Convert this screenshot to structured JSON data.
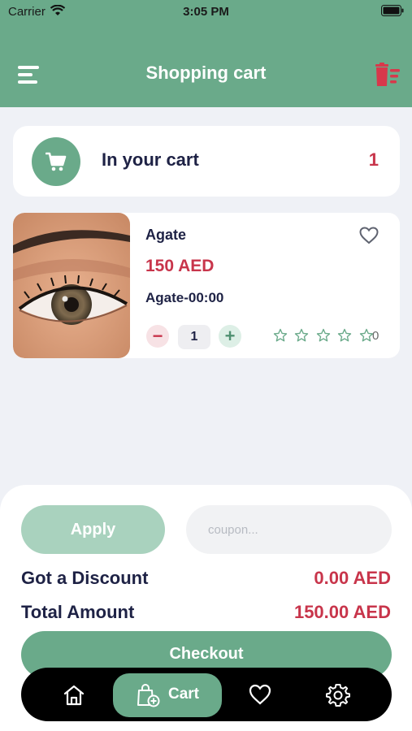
{
  "status_bar": {
    "carrier": "Carrier",
    "time": "3:05 PM"
  },
  "header": {
    "title": "Shopping cart"
  },
  "cart_summary": {
    "label": "In your cart",
    "count": "1"
  },
  "product": {
    "name": "Agate",
    "price": "150 AED",
    "variant": "Agate-00:00",
    "quantity": "1",
    "rating_stars": 0,
    "rating_count": "0"
  },
  "coupon": {
    "apply_label": "Apply",
    "placeholder": "coupon..."
  },
  "totals": {
    "discount_label": "Got a Discount",
    "discount_value": "0.00 AED",
    "total_label": "Total Amount",
    "total_value": "150.00 AED"
  },
  "checkout": {
    "label": "Checkout"
  },
  "tab_bar": {
    "active_label": "Cart"
  },
  "colors": {
    "primary": "#6AAA8A",
    "accent_red": "#C8354B",
    "text_dark": "#1E2245",
    "background": "#EFF1F6"
  },
  "icons": [
    "menu-icon",
    "trash-icon",
    "cart-icon",
    "heart-icon",
    "star-icon",
    "home-icon",
    "shopping-bag-icon",
    "settings-icon"
  ]
}
